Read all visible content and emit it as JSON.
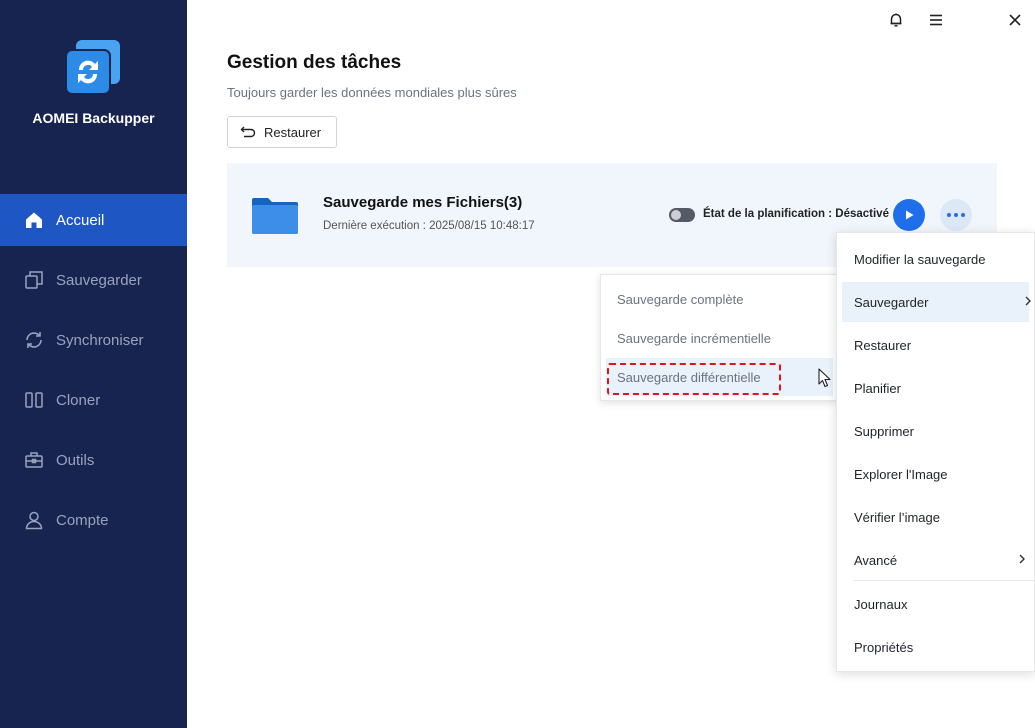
{
  "app": {
    "name": "AOMEI Backupper"
  },
  "sidebar": {
    "items": [
      {
        "label": "Accueil",
        "icon": "home-icon",
        "active": true
      },
      {
        "label": "Sauvegarder",
        "icon": "backup-icon",
        "active": false
      },
      {
        "label": "Synchroniser",
        "icon": "sync-icon",
        "active": false
      },
      {
        "label": "Cloner",
        "icon": "clone-icon",
        "active": false
      },
      {
        "label": "Outils",
        "icon": "tools-icon",
        "active": false
      },
      {
        "label": "Compte",
        "icon": "user-icon",
        "active": false
      }
    ]
  },
  "titlebar": {
    "icons": [
      "bell-icon",
      "menu-icon",
      "close-icon"
    ]
  },
  "main": {
    "title": "Gestion des tâches",
    "subtitle": "Toujours garder les données mondiales plus sûres",
    "restore_button": "Restaurer"
  },
  "task": {
    "name": "Sauvegarde mes Fichiers(3)",
    "last_run": "Dernière exécution : 2025/08/15 10:48:17",
    "schedule_status": "État de la planification : Désactivé",
    "schedule_enabled": false
  },
  "submenu": {
    "items": [
      "Sauvegarde complète",
      "Sauvegarde incrémentielle",
      "Sauvegarde différentielle"
    ],
    "highlighted_index": 2
  },
  "context_menu": {
    "items": [
      {
        "label": "Modifier la sauvegarde",
        "has_submenu": false
      },
      {
        "label": "Sauvegarder",
        "has_submenu": true
      },
      {
        "label": "Restaurer",
        "has_submenu": false
      },
      {
        "label": "Planifier",
        "has_submenu": false
      },
      {
        "label": "Supprimer",
        "has_submenu": false
      },
      {
        "label": "Explorer l'Image",
        "has_submenu": false
      },
      {
        "label": "Vérifier l’image",
        "has_submenu": false
      },
      {
        "label": "Avancé",
        "has_submenu": true
      },
      {
        "label": "Journaux",
        "has_submenu": false
      },
      {
        "label": "Propriétés",
        "has_submenu": false
      }
    ],
    "hover_index": 1
  },
  "colors": {
    "sidebar_bg": "#17244f",
    "accent": "#1f6feb",
    "highlight_border": "#e0151b"
  }
}
